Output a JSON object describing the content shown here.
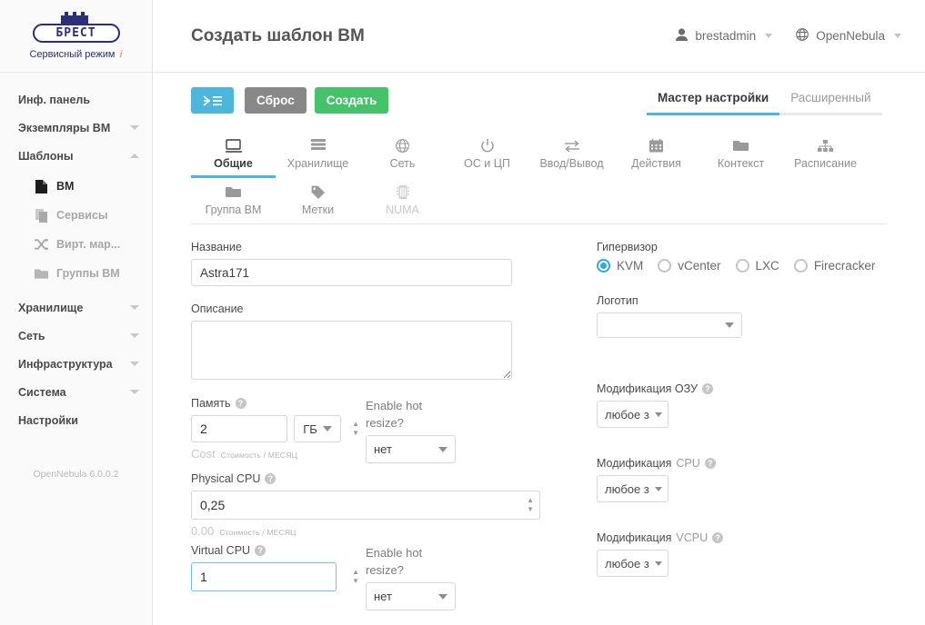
{
  "sidebar": {
    "brand": {
      "logo_text": "БРЕСТ",
      "subtitle": "Сервисный режим",
      "info_mark": "i"
    },
    "items": [
      {
        "label": "Инф. панель",
        "caret": "none"
      },
      {
        "label": "Экземпляры ВМ",
        "caret": "down"
      },
      {
        "label": "Шаблоны",
        "caret": "up"
      }
    ],
    "templates_sub": [
      {
        "label": "ВМ",
        "icon": "file-icon",
        "active": true
      },
      {
        "label": "Сервисы",
        "icon": "copy-icon",
        "active": false
      },
      {
        "label": "Вирт. мар...",
        "icon": "shuffle-icon",
        "active": false
      },
      {
        "label": "Группы ВМ",
        "icon": "folder-icon",
        "active": false
      }
    ],
    "items_bottom": [
      {
        "label": "Хранилище",
        "caret": "down"
      },
      {
        "label": "Сеть",
        "caret": "down"
      },
      {
        "label": "Инфраструктура",
        "caret": "down"
      },
      {
        "label": "Система",
        "caret": "down"
      },
      {
        "label": "Настройки",
        "caret": "none"
      }
    ],
    "version": "OpenNebula 6.0.0.2"
  },
  "header": {
    "title": "Создать шаблон ВМ",
    "user": "brestadmin",
    "zone": "OpenNebula"
  },
  "toolbar": {
    "back_label": "←",
    "reset_label": "Сброс",
    "create_label": "Создать"
  },
  "mode_tabs": [
    {
      "label": "Мастер настройки",
      "active": true
    },
    {
      "label": "Расширенный",
      "active": false
    }
  ],
  "steps": [
    {
      "label": "Общие",
      "icon": "monitor-icon",
      "state": "active"
    },
    {
      "label": "Хранилище",
      "icon": "storage-icon",
      "state": "normal"
    },
    {
      "label": "Сеть",
      "icon": "globe-icon",
      "state": "normal"
    },
    {
      "label": "ОС и ЦП",
      "icon": "power-icon",
      "state": "normal"
    },
    {
      "label": "Ввод/Вывод",
      "icon": "io-icon",
      "state": "normal"
    },
    {
      "label": "Действия",
      "icon": "calendar-icon",
      "state": "normal"
    },
    {
      "label": "Контекст",
      "icon": "folder-icon",
      "state": "normal"
    },
    {
      "label": "Расписание",
      "icon": "sitemap-icon",
      "state": "normal"
    },
    {
      "label": "Группа ВМ",
      "icon": "folder-icon",
      "state": "normal"
    },
    {
      "label": "Метки",
      "icon": "tag-icon",
      "state": "normal"
    },
    {
      "label": "NUMA",
      "icon": "memory-icon",
      "state": "disabled"
    }
  ],
  "form": {
    "name": {
      "label": "Название",
      "value": "Astra171"
    },
    "description": {
      "label": "Описание",
      "value": ""
    },
    "hypervisor": {
      "label": "Гипервизор",
      "options": [
        {
          "label": "KVM",
          "selected": true
        },
        {
          "label": "vCenter",
          "selected": false
        },
        {
          "label": "LXC",
          "selected": false
        },
        {
          "label": "Firecracker",
          "selected": false
        }
      ]
    },
    "logo": {
      "label": "Логотип",
      "value": ""
    },
    "memory": {
      "label": "Память",
      "value": "2",
      "unit": "ГБ",
      "cost_value": "Cost",
      "cost_label": "Стоимость / МЕСЯЦ"
    },
    "memory_hot_resize": {
      "label_line1": "Enable hot",
      "label_line2": "resize?",
      "value": "нет"
    },
    "memory_modification": {
      "label": "Модификация ОЗУ",
      "value": "любое з"
    },
    "physical_cpu": {
      "label": "Physical CPU",
      "value": "0,25",
      "cost_value": "0.00",
      "cost_label": "Стоимость / МЕСЯЦ"
    },
    "cpu_modification": {
      "label_main": "Модификация",
      "label_gray": "CPU",
      "value": "любое з"
    },
    "virtual_cpu": {
      "label": "Virtual CPU",
      "value": "1"
    },
    "vcpu_hot_resize": {
      "label_line1": "Enable hot",
      "label_line2": "resize?",
      "value": "нет"
    },
    "vcpu_modification": {
      "label_main": "Модификация",
      "label_gray": "VCPU",
      "value": "любое з"
    }
  },
  "colors": {
    "accent": "#4cb6dd",
    "success": "#46c26a",
    "neutral": "#888888",
    "brand": "#2b2f7a",
    "radio_selected": "#2fa8dd"
  }
}
